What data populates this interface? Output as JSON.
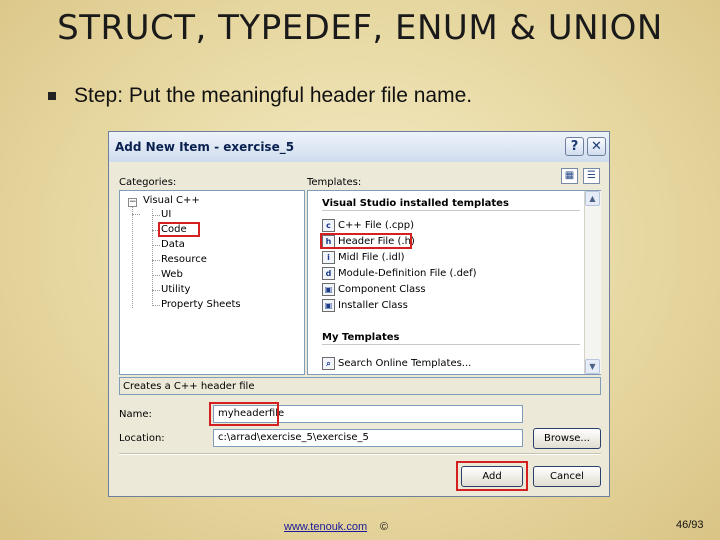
{
  "slide": {
    "title": "STRUCT, TYPEDEF, ENUM & UNION",
    "bullet": "Step: Put the meaningful header file name."
  },
  "dialog": {
    "title": "Add New Item - exercise_5",
    "help_btn": "?",
    "close_btn": "✕",
    "categories_label": "Categories:",
    "templates_label": "Templates:",
    "categories": {
      "root": "Visual C++",
      "children": [
        "UI",
        "Code",
        "Data",
        "Resource",
        "Web",
        "Utility",
        "Property Sheets"
      ],
      "selected": "Code"
    },
    "templates": {
      "installed_header": "Visual Studio installed templates",
      "items": [
        {
          "label": "C++ File (.cpp)",
          "icon": "cpp-file-icon",
          "glyph": "c"
        },
        {
          "label": "Header File (.h)",
          "icon": "header-file-icon",
          "glyph": "h"
        },
        {
          "label": "Midl File (.idl)",
          "icon": "midl-file-icon",
          "glyph": "i"
        },
        {
          "label": "Module-Definition File (.def)",
          "icon": "def-file-icon",
          "glyph": "d"
        },
        {
          "label": "Component Class",
          "icon": "component-class-icon",
          "glyph": "▣"
        },
        {
          "label": "Installer Class",
          "icon": "installer-class-icon",
          "glyph": "▣"
        }
      ],
      "selected": "Header File (.h)",
      "my_header": "My Templates",
      "search_item": "Search Online Templates..."
    },
    "description": "Creates a C++ header file",
    "name_label": "Name:",
    "name_value": "myheaderfile",
    "location_label": "Location:",
    "location_value": "c:\\arrad\\exercise_5\\exercise_5",
    "browse_button": "Browse...",
    "add_button": "Add",
    "cancel_button": "Cancel",
    "highlight_color": "#d42020"
  },
  "footer": {
    "link": "www.tenouk.com",
    "copyright": "©",
    "page": "46/93"
  }
}
